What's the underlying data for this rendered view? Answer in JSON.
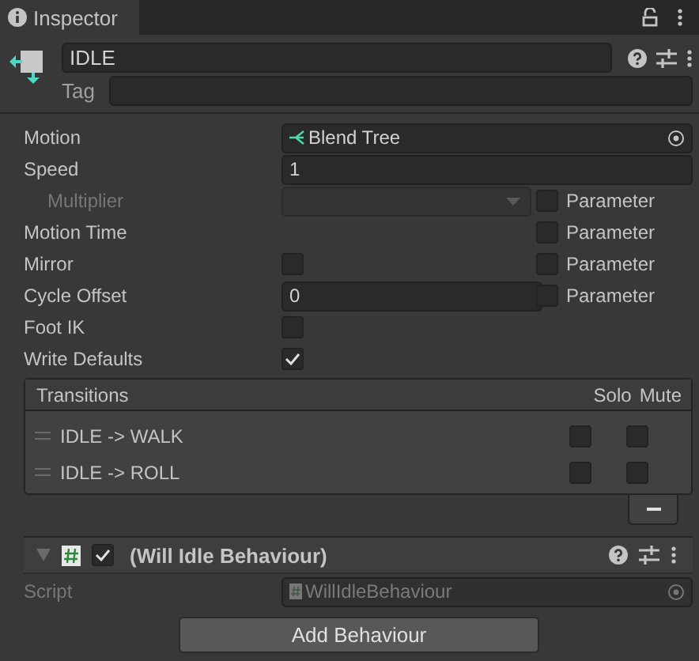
{
  "tab": {
    "title": "Inspector",
    "selected": true
  },
  "state": {
    "name": "IDLE",
    "tag_label": "Tag"
  },
  "properties": [
    {
      "kind": "object",
      "label": "Motion",
      "value": "Blend Tree"
    },
    {
      "kind": "text",
      "label": "Speed",
      "value": "1"
    },
    {
      "kind": "dropdown",
      "label": "Multiplier",
      "disabled": true,
      "parameter": {
        "label": "Parameter",
        "checked": false
      }
    },
    {
      "kind": "none",
      "label": "Motion Time",
      "parameter": {
        "label": "Parameter",
        "checked": false
      }
    },
    {
      "kind": "checkbox",
      "label": "Mirror",
      "checked": false,
      "parameter": {
        "label": "Parameter",
        "checked": false
      }
    },
    {
      "kind": "text",
      "label": "Cycle Offset",
      "value": "0",
      "parameter": {
        "label": "Parameter",
        "checked": false
      }
    },
    {
      "kind": "checkbox",
      "label": "Foot IK",
      "checked": false
    },
    {
      "kind": "checkbox",
      "label": "Write Defaults",
      "checked": true
    }
  ],
  "transitions": {
    "title": "Transitions",
    "solo_label": "Solo",
    "mute_label": "Mute",
    "rows": [
      {
        "name": "IDLE -> WALK",
        "solo": false,
        "mute": false
      },
      {
        "name": "IDLE -> ROLL",
        "solo": false,
        "mute": false
      }
    ]
  },
  "behaviour": {
    "title": "(Will Idle Behaviour)",
    "enabled": true,
    "expanded": true,
    "script_label": "Script",
    "script_value": "WillIdleBehaviour",
    "script_disabled": true
  },
  "add_button": "Add Behaviour"
}
